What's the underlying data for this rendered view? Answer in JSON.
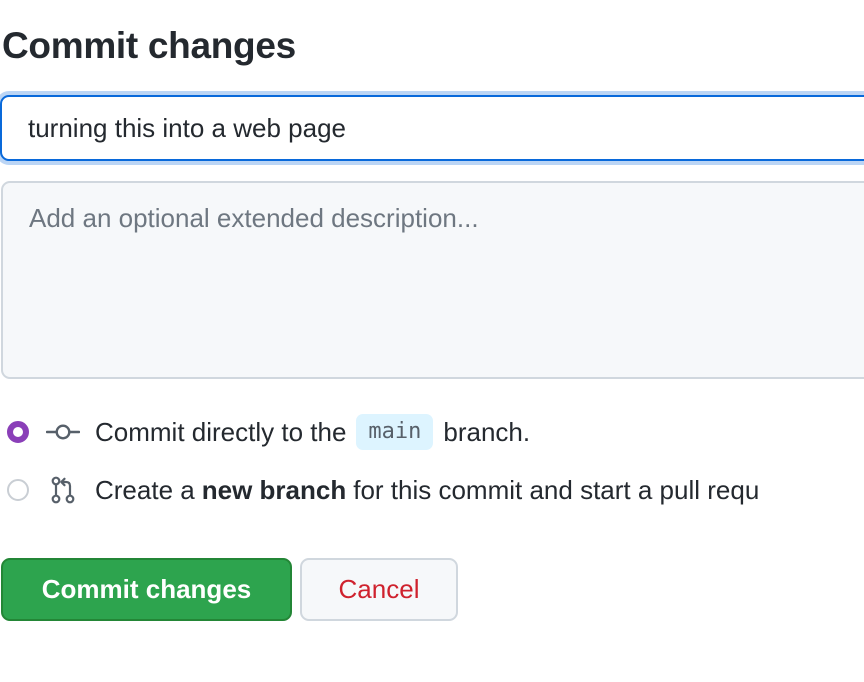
{
  "header": {
    "title": "Commit changes"
  },
  "form": {
    "summary_value": "turning this into a web page",
    "description_placeholder": "Add an optional extended description..."
  },
  "options": {
    "direct": {
      "selected": true,
      "prefix": "Commit directly to the",
      "branch": "main",
      "suffix": "branch.",
      "icon": "git-commit-icon"
    },
    "new_branch": {
      "selected": false,
      "prefix": "Create a",
      "bold": "new branch",
      "suffix": "for this commit and start a pull requ",
      "icon": "git-pull-request-icon"
    }
  },
  "buttons": {
    "commit_label": "Commit changes",
    "cancel_label": "Cancel"
  },
  "colors": {
    "primary_green": "#2da44e",
    "focus_blue": "#0969da",
    "danger_red": "#cf222e",
    "radio_selected": "#8a3fb8"
  }
}
